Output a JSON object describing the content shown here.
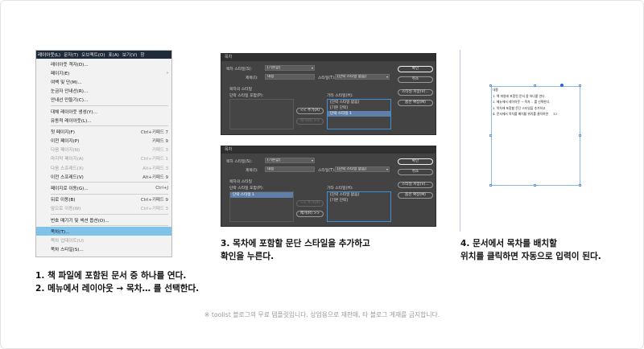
{
  "menu": {
    "bar": [
      "레이아웃(L)",
      "문자(T)",
      "오브젝트(O)",
      "표(A)",
      "보기(V)",
      "창"
    ],
    "items": [
      {
        "label": "레이아웃 격자(D)...",
        "shortcut": ""
      },
      {
        "label": "페이지(E)",
        "shortcut": "›"
      },
      {
        "label": "여백 및 단(M)...",
        "shortcut": ""
      },
      {
        "label": "눈금자 안내선(R)...",
        "shortcut": ""
      },
      {
        "label": "안내선 만들기(C)...",
        "shortcut": ""
      },
      {
        "label": "대체 레이아웃 생성(Y)...",
        "shortcut": ""
      },
      {
        "label": "유동적 레이아웃(L)...",
        "shortcut": ""
      },
      {
        "label": "첫 페이지(F)",
        "shortcut": "Ctrl+키패드 7"
      },
      {
        "label": "이전 페이지(P)",
        "shortcut": "키패드 9"
      },
      {
        "label": "다음 페이지(N)",
        "shortcut": "키패드 3"
      },
      {
        "label": "마지막 페이지(A)",
        "shortcut": "Ctrl+키패드 1"
      },
      {
        "label": "다음 스프레드(X)",
        "shortcut": "Alt+키패드 3"
      },
      {
        "label": "이전 스프레드(V)",
        "shortcut": "Alt+키패드 9"
      },
      {
        "label": "페이지로 이동(G)...",
        "shortcut": "Ctrl+J"
      },
      {
        "label": "뒤로 이동(B)",
        "shortcut": "Ctrl+키패드 9"
      },
      {
        "label": "앞으로 이동(W)",
        "shortcut": "Ctrl+키패드 3"
      },
      {
        "label": "번호 매기기 및 섹션 옵션(O)...",
        "shortcut": ""
      },
      {
        "label": "목차(T)...",
        "shortcut": ""
      },
      {
        "label": "목차 업데이트(U)",
        "shortcut": ""
      },
      {
        "label": "목차 스타일(S)...",
        "shortcut": ""
      }
    ]
  },
  "dialog": {
    "title": "목차",
    "style_label": "목차 스타일(S):",
    "style_value": "[기본값]",
    "title_label": "제목(I):",
    "title_value": "내용",
    "style2_label": "스타일(T):",
    "style2_value": "[단락 스타일 없음]",
    "section_label": "목차의 스타일",
    "include_label": "단락 스타일 포함(P):",
    "other_label": "기타 스타일(H):",
    "add_button": "<< 추가(A)",
    "remove_button": "제거(R) >>",
    "ok_button": "확인",
    "cancel_button": "취소",
    "save_button": "스타일 저장(V)...",
    "more_button": "옵션 확장(M)",
    "other_styles_1": [
      "[단락 스타일 없음]",
      "[기본 단락]",
      "단락 스타일 1"
    ],
    "include_styles_2": [
      "단락 스타일 1"
    ],
    "other_styles_2": [
      "[단락 스타일 없음]",
      "[기본 단락]"
    ]
  },
  "document": {
    "lines": [
      "내용",
      "1. 책 파일에 포함된 문서 중 하나를 연다.",
      "2. 메뉴에서 레이아웃 → 목차… 를 선택한다.",
      "3. 목차에 포함할 문단 스타일을 추가하고",
      "4. 문서에서 목차를 배치할 위치를 클릭하면"
    ],
    "page_no": "12"
  },
  "captions": {
    "step1_line1": "1. 책 파일에 포함된 문서 중 하나를 연다.",
    "step1_line2": "2. 메뉴에서 레이아웃 → 목차… 를 선택한다.",
    "step3_line1": "3. 목차에 포함할 문단 스타일을 추가하고",
    "step3_line2": "확인을 누른다.",
    "step4_line1": "4. 문서에서 목차를 배치할",
    "step4_line2": "위치를 클릭하면 자동으로 입력이 된다."
  },
  "footer": "※ toolist 블로그의 무료 템플릿입니다. 상업용으로 재판매, 타 블로그 게재를 금지합니다."
}
